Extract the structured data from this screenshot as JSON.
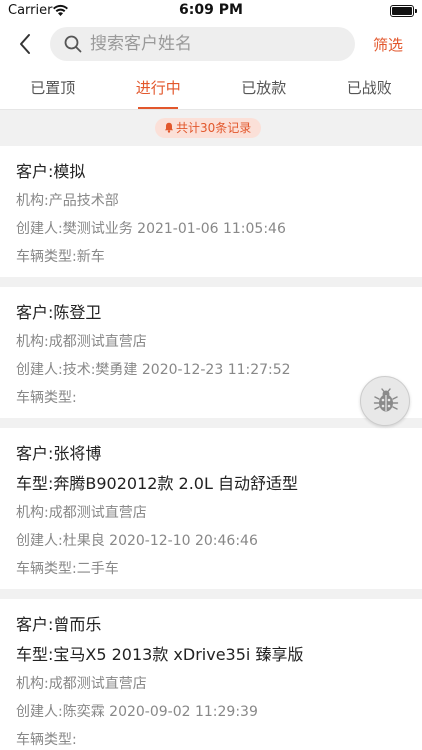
{
  "status_bar": {
    "carrier": "Carrier",
    "time": "6:09 PM"
  },
  "nav": {
    "search_placeholder": "搜索客户姓名",
    "filter_label": "筛选"
  },
  "tabs": [
    {
      "label": "已置顶",
      "active": false
    },
    {
      "label": "进行中",
      "active": true
    },
    {
      "label": "已放款",
      "active": false
    },
    {
      "label": "已战败",
      "active": false
    }
  ],
  "record_count": "共计30条记录",
  "orders": [
    {
      "customer": "客户:模拟",
      "org": "机构:产品技术部",
      "creator": "创建人:樊测试业务 2021-01-06 11:05:46",
      "vehicle_type": "车辆类型:新车"
    },
    {
      "customer": "客户:陈登卫",
      "org": "机构:成都测试直营店",
      "creator": "创建人:技术:樊勇建 2020-12-23 11:27:52",
      "vehicle_type": "车辆类型:"
    },
    {
      "customer": "客户:张将博",
      "car_model": "车型:奔腾B902012款 2.0L 自动舒适型",
      "org": "机构:成都测试直营店",
      "creator": "创建人:杜果良 2020-12-10 20:46:46",
      "vehicle_type": "车辆类型:二手车"
    },
    {
      "customer": "客户:曾而乐",
      "car_model": "车型:宝马X5 2013款 xDrive35i 臻享版",
      "org": "机构:成都测试直营店",
      "creator": "创建人:陈奕霖 2020-09-02 11:29:39",
      "vehicle_type": "车辆类型:"
    }
  ],
  "colors": {
    "accent": "#e2572c",
    "badge_bg": "#fbe0d8",
    "page_bg": "#f1f1f1"
  },
  "icons": {
    "back": "chevron-left-icon",
    "search": "search-icon",
    "bell": "bell-icon",
    "debug": "bug-icon"
  }
}
